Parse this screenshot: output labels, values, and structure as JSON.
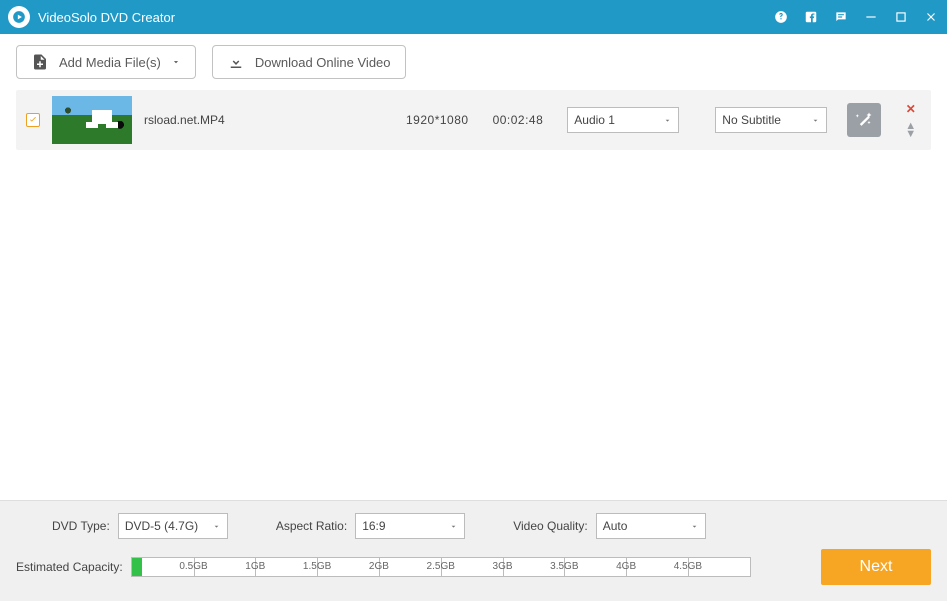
{
  "titlebar": {
    "title": "VideoSolo DVD Creator"
  },
  "toolbar": {
    "add_media": "Add Media File(s)",
    "download_online": "Download Online Video"
  },
  "media": {
    "items": [
      {
        "filename": "rsload.net.MP4",
        "resolution": "1920*1080",
        "duration": "00:02:48",
        "audio_selected": "Audio 1",
        "subtitle_selected": "No Subtitle"
      }
    ]
  },
  "footer": {
    "dvd_type_label": "DVD Type:",
    "dvd_type_selected": "DVD-5 (4.7G)",
    "aspect_label": "Aspect Ratio:",
    "aspect_selected": "16:9",
    "quality_label": "Video Quality:",
    "quality_selected": "Auto",
    "capacity_label": "Estimated Capacity:",
    "ticks": [
      "0.5GB",
      "1GB",
      "1.5GB",
      "2GB",
      "2.5GB",
      "3GB",
      "3.5GB",
      "4GB",
      "4.5GB"
    ],
    "next_label": "Next"
  }
}
